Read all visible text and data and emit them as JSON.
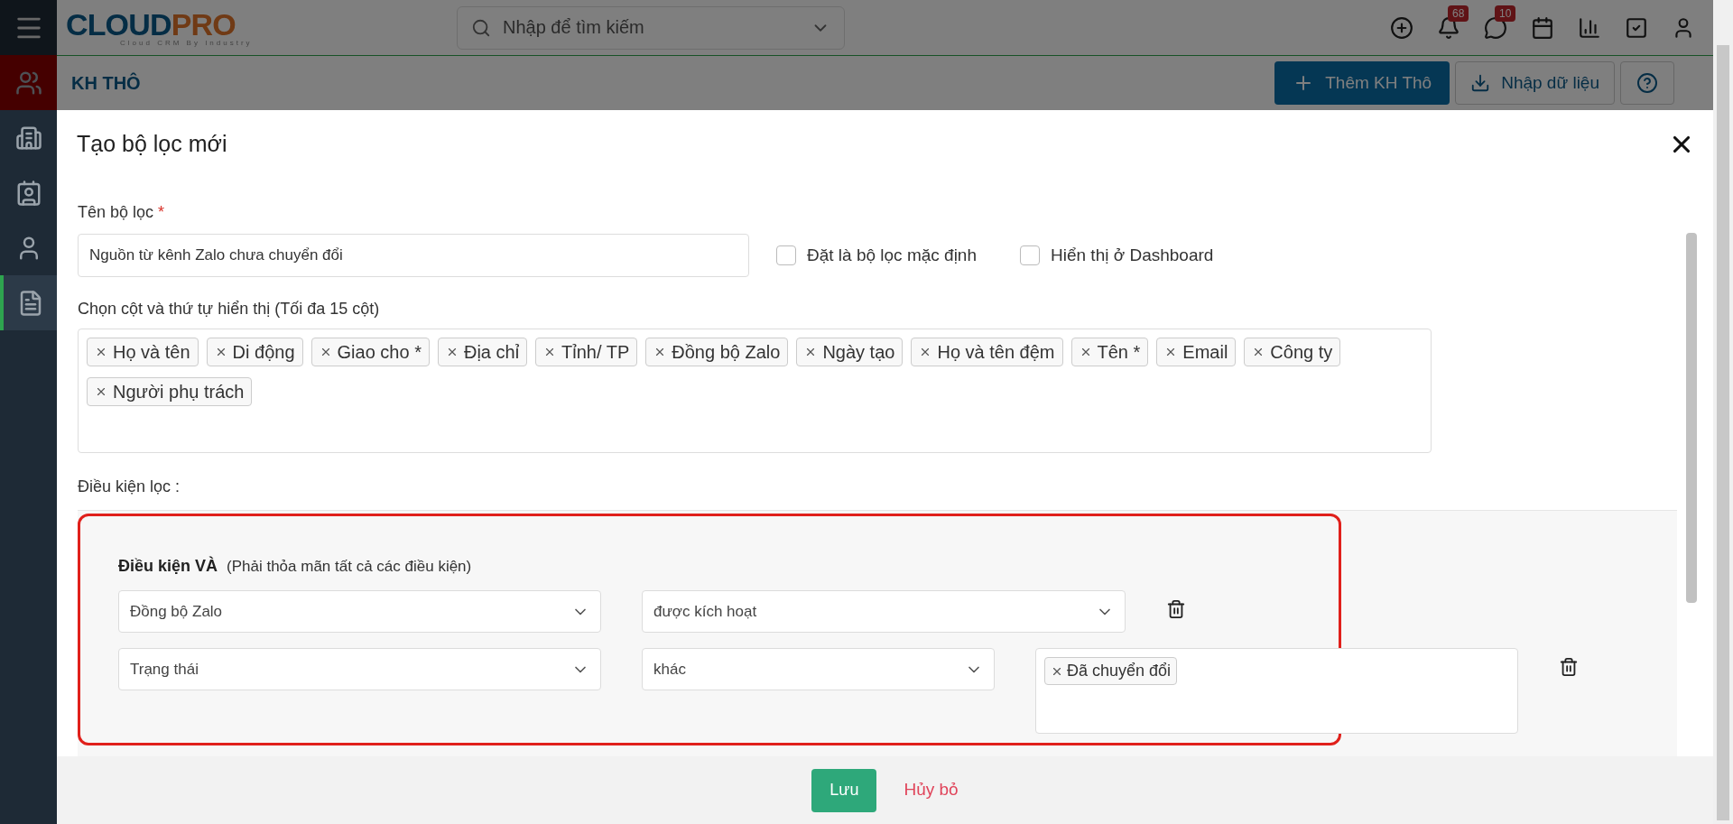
{
  "sidebar": {
    "items": [
      {
        "kind": "menu",
        "selected": false
      },
      {
        "kind": "users",
        "selected": true
      },
      {
        "kind": "building",
        "selected": false
      },
      {
        "kind": "contacts",
        "selected": false
      },
      {
        "kind": "person",
        "selected": false
      },
      {
        "kind": "document",
        "selected": true
      }
    ]
  },
  "header": {
    "logo": {
      "part_1": "CLOUD",
      "part_2": "PRO",
      "tagline": "Cloud CRM By Industry"
    },
    "search": {
      "placeholder": "Nhập để tìm kiếm"
    },
    "icons": [
      {
        "kind": "add"
      },
      {
        "kind": "bell",
        "badge": "68"
      },
      {
        "kind": "chat",
        "badge": "10"
      },
      {
        "kind": "calendar"
      },
      {
        "kind": "report"
      },
      {
        "kind": "task"
      },
      {
        "kind": "profile"
      }
    ]
  },
  "page": {
    "title": "KH THÔ",
    "buttons": [
      {
        "kind": "primary",
        "label": "Thêm KH Thô"
      },
      {
        "kind": "import",
        "label": "Nhập dữ liệu"
      },
      {
        "kind": "help"
      }
    ]
  },
  "modal": {
    "title": "Tạo bộ lọc mới",
    "name_field": {
      "label": "Tên bộ lọc",
      "required_mark": "*",
      "value": "Nguồn từ kênh Zalo chưa chuyển đổi"
    },
    "checkboxes": [
      {
        "label": "Đặt là bộ lọc mặc định",
        "checked": false
      },
      {
        "label": "Hiển thị ở Dashboard",
        "checked": false
      }
    ],
    "columns": {
      "label": "Chọn cột và thứ tự hiển thị (Tối đa 15 cột)",
      "tags": [
        "Họ và tên",
        "Di động",
        "Giao cho *",
        "Địa chỉ",
        "Tỉnh/ TP",
        "Đồng bộ Zalo",
        "Ngày tạo",
        "Họ và tên đệm",
        "Tên *",
        "Email",
        "Công ty",
        "Người phụ trách"
      ]
    },
    "conditions": {
      "label": "Điều kiện lọc :",
      "group": {
        "title": "Điều kiện VÀ",
        "hint": "(Phải thỏa mãn tất cả các điều kiện)",
        "highlighted": true,
        "rows": [
          {
            "field": "Đồng bộ Zalo",
            "operator": "được kích hoạt"
          },
          {
            "field": "Trạng thái",
            "operator": "khác",
            "values": [
              "Đã chuyển đổi"
            ]
          }
        ]
      }
    },
    "footer": {
      "save": "Lưu",
      "cancel": "Hủy bỏ"
    }
  }
}
